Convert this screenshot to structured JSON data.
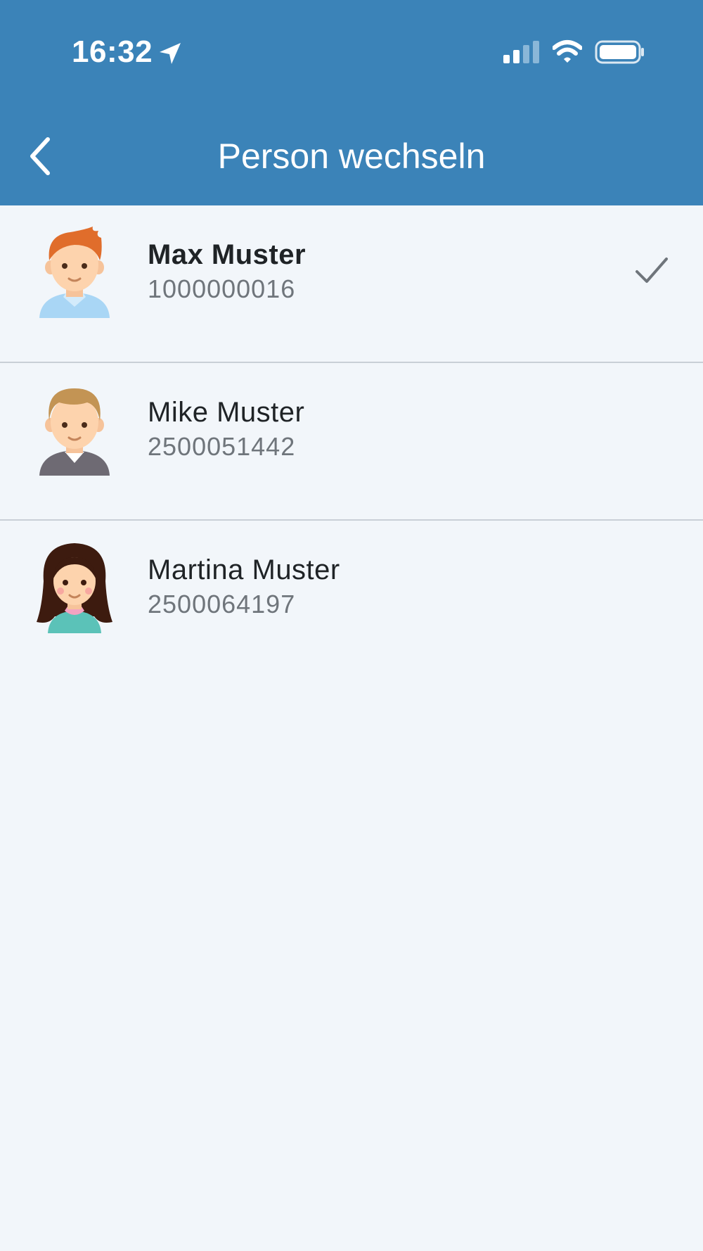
{
  "status_bar": {
    "time": "16:32",
    "icons": [
      "location-arrow-icon",
      "cellular-signal-icon",
      "wifi-icon",
      "battery-icon"
    ]
  },
  "nav": {
    "title": "Person wechseln",
    "back_icon": "chevron-left-icon"
  },
  "persons": [
    {
      "name": "Max Muster",
      "number": "1000000016",
      "selected": true,
      "avatar": "avatar-boy-red-hair"
    },
    {
      "name": "Mike Muster",
      "number": "2500051442",
      "selected": false,
      "avatar": "avatar-man-blond-hair"
    },
    {
      "name": "Martina Muster",
      "number": "2500064197",
      "selected": false,
      "avatar": "avatar-girl-dark-hair"
    }
  ],
  "colors": {
    "header": "#3b83b8",
    "background": "#f2f6fa",
    "divider": "#c9cfd6",
    "name_text": "#1f2326",
    "number_text": "#6f757b",
    "check": "#6f757b"
  }
}
